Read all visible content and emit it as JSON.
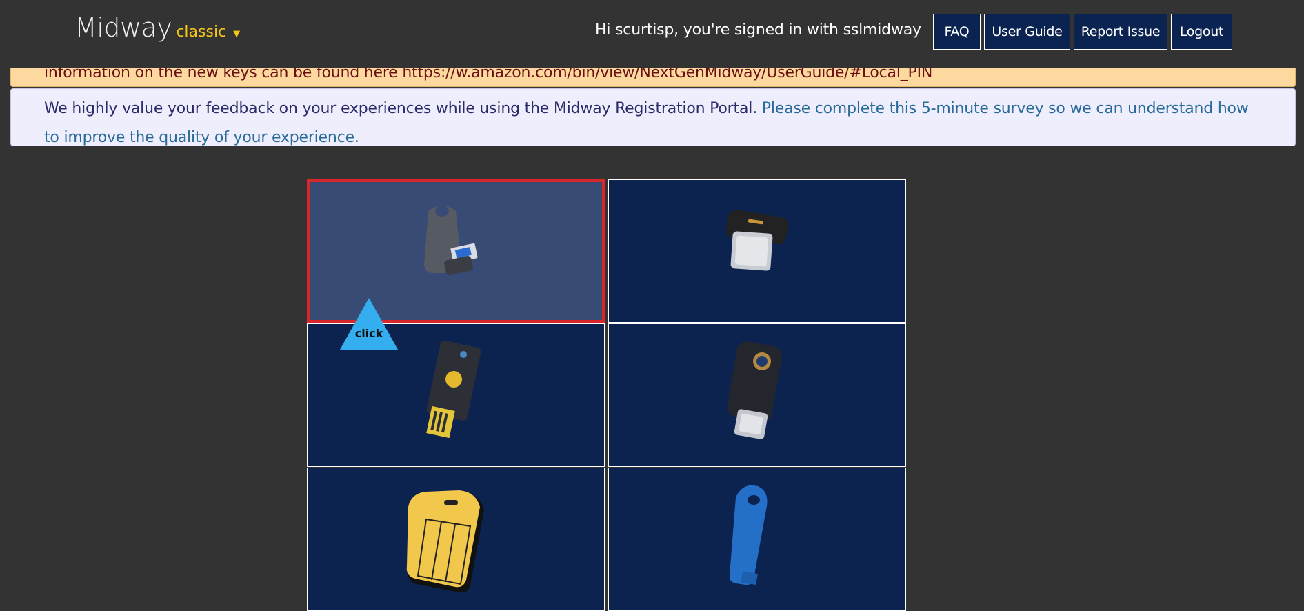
{
  "header": {
    "brand": "Midway",
    "brand_sub": "classic",
    "brand_caret": "▼",
    "greeting": "Hi scurtisp, you're signed in with sslmidway",
    "nav": [
      {
        "label": "FAQ"
      },
      {
        "label": "User Guide"
      },
      {
        "label": "Report Issue"
      },
      {
        "label": "Logout"
      }
    ]
  },
  "banners": {
    "warning_text": "information on the new keys can be found here https://w.amazon.com/bin/view/NextGenMidway/UserGuide/#Local_PIN",
    "feedback_text": "We highly value your feedback on your experiences while using the Midway Registration Portal.",
    "survey_link": "Please complete this 5-minute survey so we can understand how to improve the quality of your experience."
  },
  "key_grid": {
    "tiles": [
      {
        "icon": "usb-a-keyring-key-icon",
        "selected": true
      },
      {
        "icon": "usb-c-nano-key-icon",
        "selected": false
      },
      {
        "icon": "usb-a-gold-touch-key-icon",
        "selected": false
      },
      {
        "icon": "usb-c-yubico-key-icon",
        "selected": false
      },
      {
        "icon": "yellow-security-card-icon",
        "selected": false
      },
      {
        "icon": "blue-usb-key-icon",
        "selected": false
      }
    ]
  },
  "click_marker": {
    "label": "click"
  },
  "colors": {
    "background": "#333333",
    "accent": "#f5c518",
    "nav_button": "#0b2350",
    "tile": "#0c2350",
    "tile_selected": "#374b75",
    "selection_border": "#d8262a",
    "warning_banner": "#fdd9a0",
    "info_banner": "#eeeefc"
  }
}
